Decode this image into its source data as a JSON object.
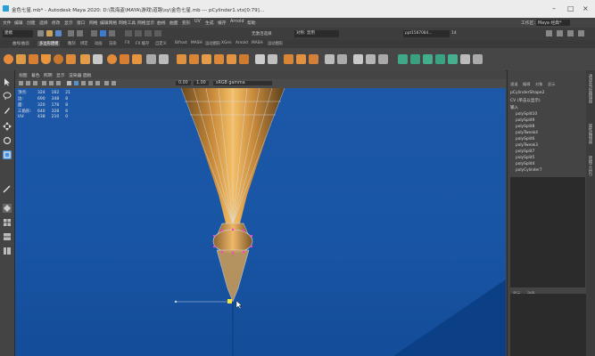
{
  "titlebar": {
    "title": "金色七星.mb* - Autodesk Maya 2020: D:\\我海盗\\MAYA\\游戏\\道路\\sy\\金色七星.mb  ---  pCylinder1.vtx[0:79]..."
  },
  "menubar": {
    "items": [
      "文件",
      "编辑",
      "创建",
      "选择",
      "修改",
      "显示",
      "窗口",
      "网格",
      "编辑网格",
      "网格工具",
      "网格显示",
      "曲线",
      "曲面",
      "变形",
      "UV",
      "生成",
      "缓存",
      "Arnold",
      "帮助"
    ],
    "workspace_label": "工作区:",
    "workspace_value": "Maya 经典*"
  },
  "statusline": {
    "mode": "建模",
    "symmetry_label": "无激活选择",
    "target": "对称: 禁用",
    "object_field": "pCylinder1.vtx[0:79]...",
    "object_prefix": "ppt1587084...",
    "count": "14"
  },
  "shelf": {
    "tabs": [
      "曲线/曲面",
      "多边形建模",
      "雕刻",
      "绑定",
      "动画",
      "渲染",
      "FX",
      "FX 缓存",
      "自定义",
      "Bifrost",
      "MASH",
      "运动图形",
      "XGen",
      "Arnold",
      "MASH",
      "运动图形"
    ]
  },
  "viewport": {
    "menu": [
      "视图",
      "着色",
      "照明",
      "显示",
      "渲染器",
      "面板"
    ],
    "gamma": "sRGB gamma",
    "exposure": "0.00",
    "gamma_value": "1.00",
    "hud": [
      {
        "label": "顶点:",
        "a": "324",
        "b": "162",
        "c": "21"
      },
      {
        "label": "边:",
        "a": "690",
        "b": "348",
        "c": "8"
      },
      {
        "label": "面:",
        "a": "320",
        "b": "178",
        "c": "8"
      },
      {
        "label": "三角形:",
        "a": "640",
        "b": "328",
        "c": "6"
      },
      {
        "label": "UV:",
        "a": "438",
        "b": "210",
        "c": "0"
      }
    ]
  },
  "outliner": {
    "tabs": [
      "通道",
      "编辑",
      "对象",
      "显示"
    ],
    "node": "pCylinderShape2",
    "cv_note": "CV (单击以显示)",
    "inputs": "输入",
    "items": [
      "polySplit10",
      "polySplit9",
      "polySplit8",
      "polyTweak4",
      "polySplit6",
      "polyTweak3",
      "polySplit7",
      "polySplit5",
      "polySplit4",
      "polyCylinder7"
    ]
  },
  "layer_panel": {
    "tabs": [
      "显示",
      "动画"
    ],
    "menu": [
      "层",
      "选项",
      "帮助"
    ]
  },
  "sidebar": {
    "labels": [
      "通道盒/层编辑器",
      "属性编辑器",
      "建模工具包"
    ]
  },
  "colors": {
    "viewport": "#1855a4",
    "accent": "#e8a030",
    "menu_bg": "#444444"
  }
}
